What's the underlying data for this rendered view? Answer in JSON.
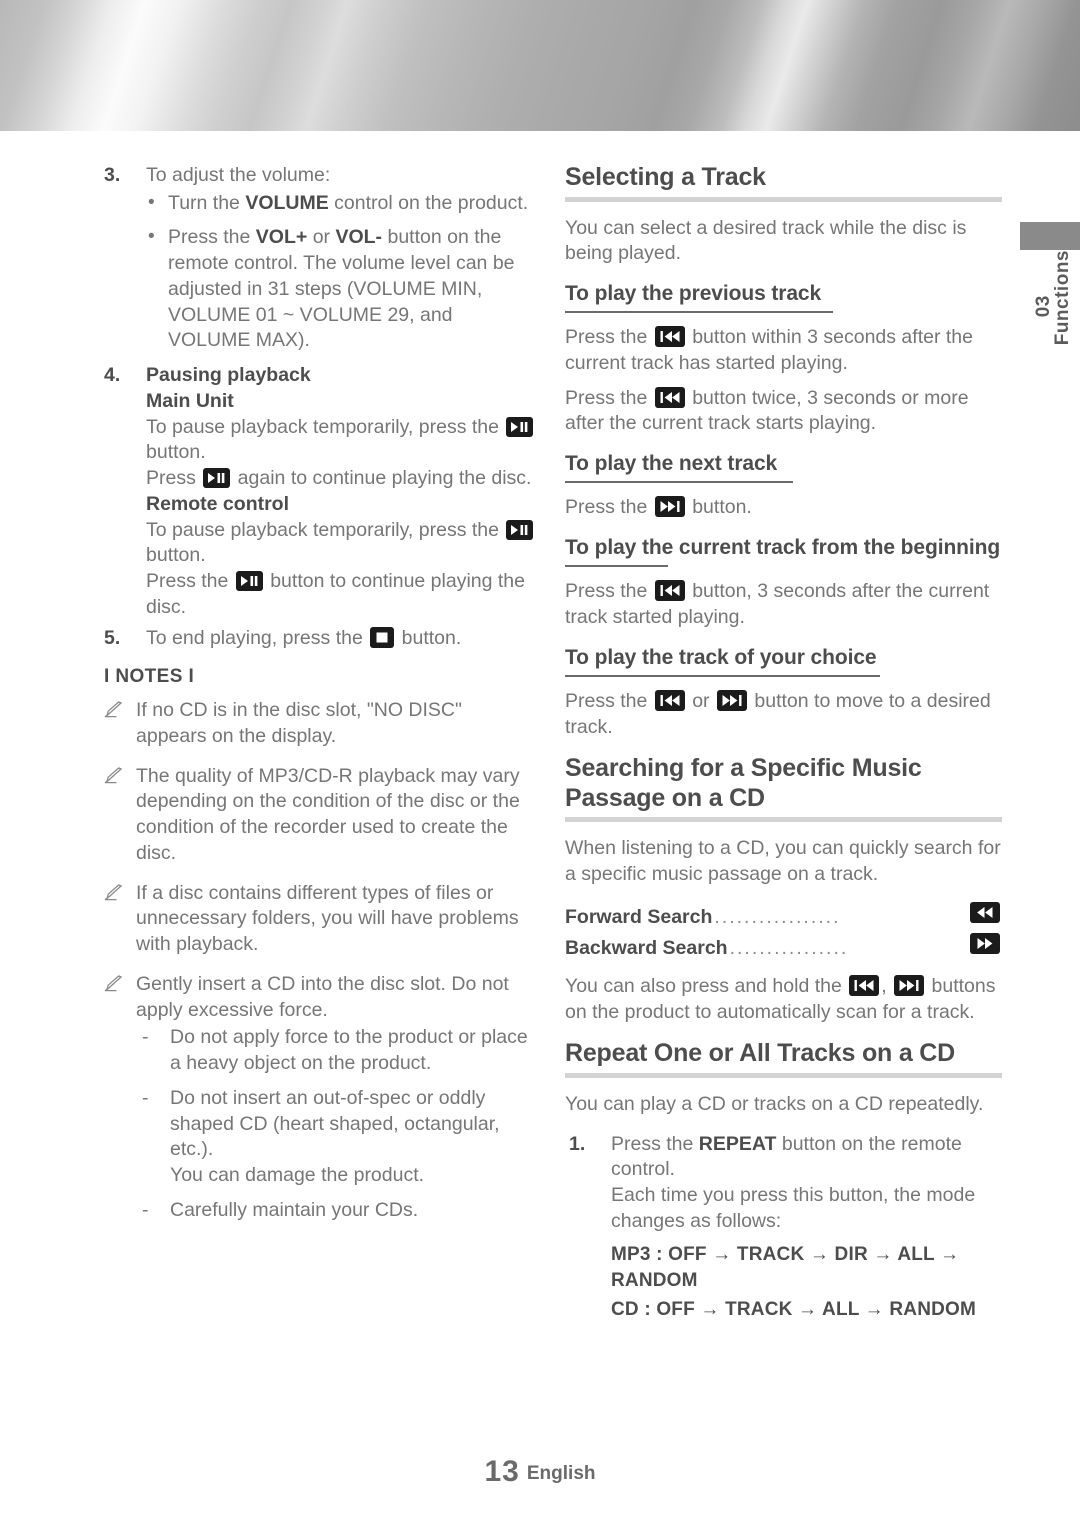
{
  "side_tab": {
    "number": "03",
    "label": "Functions"
  },
  "footer": {
    "page_number": "13",
    "language": "English"
  },
  "left_column": {
    "step3": {
      "marker": "3.",
      "text": "To adjust the volume:",
      "bullets": [
        {
          "pre": "Turn the ",
          "bold": "VOLUME",
          "post": " control on the product."
        },
        {
          "pre": "Press the ",
          "bold": "VOL+",
          "mid": " or ",
          "bold2": "VOL-",
          "post": " button on the remote control.",
          "extra": "The volume level can be adjusted in 31 steps (VOLUME MIN, VOLUME 01 ~ VOLUME 29, and VOLUME MAX)."
        }
      ]
    },
    "step4": {
      "marker": "4.",
      "title": "Pausing playback",
      "main_unit_label": "Main Unit",
      "main_unit_line1_pre": "To pause playback temporarily, press the ",
      "main_unit_line1_post": " button.",
      "main_unit_line2_pre": "Press ",
      "main_unit_line2_post": " again to continue playing the disc.",
      "remote_label": "Remote control",
      "remote_line1_pre": "To pause playback temporarily, press the ",
      "remote_line1_post": " button.",
      "remote_line2_pre": "Press the ",
      "remote_line2_post": " button to continue playing the disc."
    },
    "step5": {
      "marker": "5.",
      "pre": "To end playing, press the ",
      "post": " button."
    },
    "notes_title": "I NOTES I",
    "notes": [
      "If no CD is in the disc slot, \"NO DISC\" appears on the display.",
      "The quality of MP3/CD-R playback may vary depending on the condition of the disc or the condition of the recorder used to create the disc.",
      "If a disc contains different types of files or unnecessary folders, you will have problems with playback.",
      "Gently insert a CD into the disc slot. Do not apply excessive force."
    ],
    "note_sub_items": [
      {
        "text": "Do not apply force to the product or place a heavy object on the product."
      },
      {
        "text": "Do not insert an out-of-spec or oddly shaped CD (heart shaped, octangular, etc.).",
        "extra": "You can damage the product."
      },
      {
        "text": "Carefully maintain your CDs."
      }
    ]
  },
  "right_column": {
    "section_selecting": {
      "heading": "Selecting a Track",
      "intro": "You can select a desired track while the disc is being played.",
      "sub_previous": {
        "heading": "To play the previous track",
        "line1_pre": "Press the ",
        "line1_post": " button within 3 seconds after the current track has started playing.",
        "line2_pre": "Press the ",
        "line2_post": " button twice, 3 seconds or more after the current track starts playing."
      },
      "sub_next": {
        "heading": "To play the next track",
        "line_pre": "Press the ",
        "line_post": " button."
      },
      "sub_beginning": {
        "heading": "To play the current track from the beginning",
        "line_pre": "Press the ",
        "line_post": " button, 3 seconds after the current track started playing."
      },
      "sub_choice": {
        "heading": "To play the track of your choice",
        "line_pre": "Press the ",
        "line_mid": " or ",
        "line_post": " button to move to a desired track."
      }
    },
    "section_searching": {
      "heading": "Searching for a Specific Music Passage on a CD",
      "intro": "When listening to a CD, you can quickly search for a specific music passage on a track.",
      "leaders": [
        {
          "label": "Forward Search",
          "dots": ".................",
          "icon": "rewind-icon"
        },
        {
          "label": "Backward Search",
          "dots": "................",
          "icon": "fast-forward-icon"
        }
      ],
      "outro_pre": "You can also press and hold the ",
      "outro_mid": ", ",
      "outro_post": " buttons on the product to automatically scan for a track."
    },
    "section_repeat": {
      "heading": "Repeat One or All Tracks on a CD",
      "intro": "You can play a CD or tracks on a CD repeatedly.",
      "step1": {
        "marker": "1.",
        "pre": "Press the ",
        "bold": "REPEAT",
        "post": " button on the remote control.",
        "extra": "Each time you press this button, the mode changes as follows:"
      },
      "sequences": [
        "MP3 : OFF → TRACK → DIR → ALL → RANDOM",
        "CD : OFF → TRACK → ALL → RANDOM"
      ]
    }
  },
  "colors": {
    "heading": "#4d4d4d",
    "body": "#767676",
    "main_rule": "#d3d3d3",
    "sub_rule": "#6a6a6a",
    "icon_bg": "#1b1b1b",
    "tab_bg": "#8a8a8a"
  }
}
